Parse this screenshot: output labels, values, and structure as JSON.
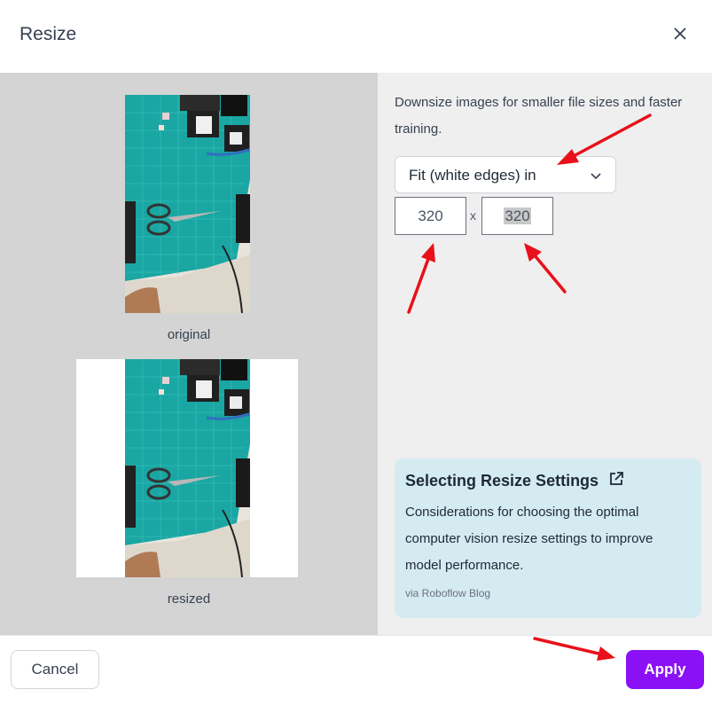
{
  "dialog": {
    "title": "Resize",
    "close_icon": "close-icon"
  },
  "preview": {
    "original_caption": "original",
    "resized_caption": "resized"
  },
  "settings": {
    "description": "Downsize images for smaller file sizes and faster training.",
    "mode_value": "Fit (white edges) in",
    "width": "320",
    "separator": "x",
    "height": "320"
  },
  "card": {
    "title": "Selecting Resize Settings",
    "body": "Considerations for choosing the optimal computer vision resize settings to improve model performance.",
    "via": "via Roboflow Blog",
    "icon": "external-link-icon"
  },
  "footer": {
    "cancel_label": "Cancel",
    "apply_label": "Apply"
  },
  "colors": {
    "accent": "#8b10f5",
    "annotation_arrow": "#e8101a",
    "card_bg": "#d5ebf2"
  }
}
